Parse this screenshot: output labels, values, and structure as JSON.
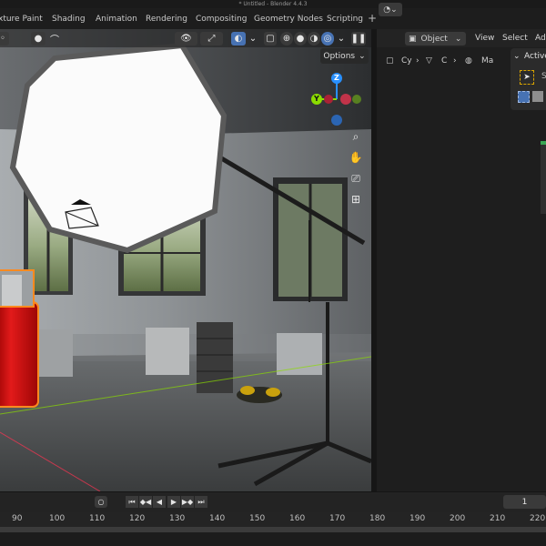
{
  "window": {
    "title": "* Untitled - Blender 4.4.3"
  },
  "workspace_tabs": [
    "xture Paint",
    "Shading",
    "Animation",
    "Rendering",
    "Compositing",
    "Geometry Nodes",
    "Scripting"
  ],
  "workspace_add": "+",
  "viewport": {
    "options_label": "Options",
    "options_chevron": "⌄",
    "gizmo": {
      "z": "Z",
      "y": "Y"
    },
    "nav_icons": [
      "zoom-icon",
      "hand-icon",
      "camera-icon",
      "grid-icon"
    ],
    "shading_modes": [
      "wireframe",
      "solid",
      "material-preview",
      "rendered"
    ],
    "active_shading": "rendered"
  },
  "node_editor": {
    "editor_type_icon": "node-editor-icon",
    "object_mode": "Object",
    "menus": [
      "View",
      "Select",
      "Ad"
    ],
    "breadcrumb": {
      "scene": "Cy",
      "object": "C",
      "material": "Ma"
    },
    "active_panel": {
      "title": "Active",
      "item": "S"
    }
  },
  "timeline": {
    "ticks": [
      "90",
      "100",
      "110",
      "120",
      "130",
      "140",
      "150",
      "160",
      "170",
      "180",
      "190",
      "200",
      "210",
      "220"
    ],
    "current_frame": "1",
    "playback_icons": [
      "jump-start-icon",
      "prev-keyframe-icon",
      "play-reverse-icon",
      "play-icon",
      "next-keyframe-icon",
      "jump-end-icon"
    ]
  },
  "colors": {
    "accent": "#4772b3",
    "selection_orange": "#ff8a1f",
    "axis_red": "#ff3352",
    "axis_green": "#8bdc00",
    "axis_blue": "#2890ff"
  }
}
